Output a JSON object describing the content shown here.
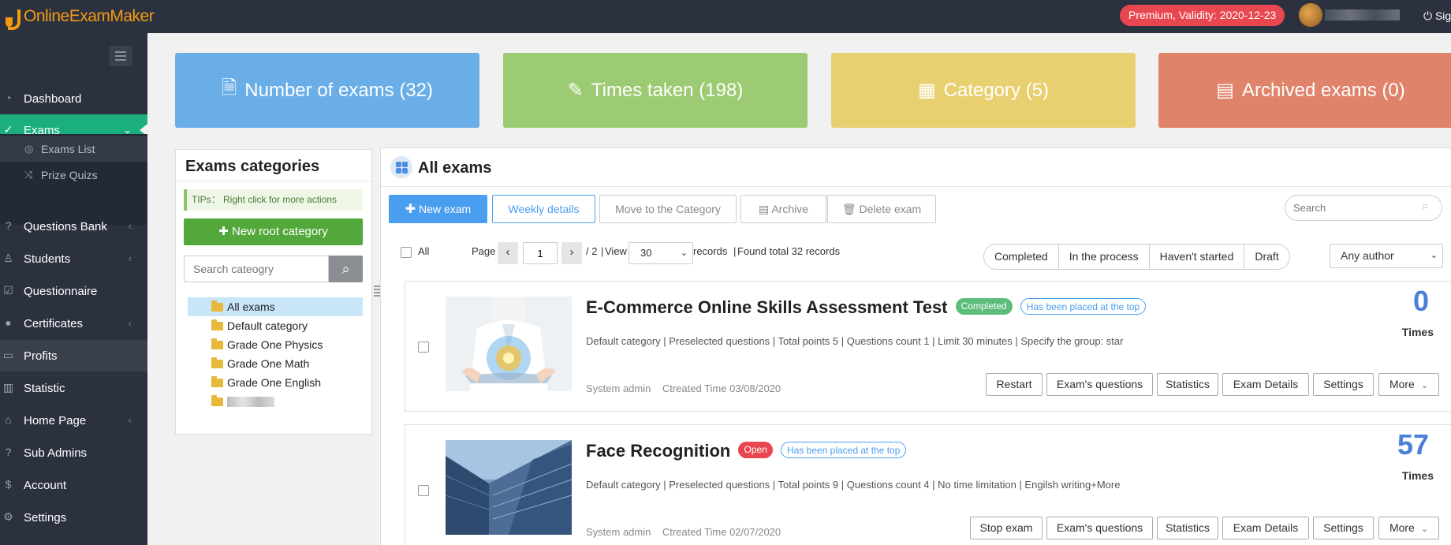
{
  "app": {
    "logo": "OnlineExamMaker"
  },
  "topbar": {
    "premium": "Premium, Validity: 2020-12-23",
    "signout_label": "Sig"
  },
  "sidebar": {
    "items": [
      {
        "label": "Dashboard",
        "icon": "dashboard-icon"
      },
      {
        "label": "Exams",
        "icon": "check-circle-icon",
        "active": true
      },
      {
        "label": "Questions Bank",
        "icon": "question-icon"
      },
      {
        "label": "Students",
        "icon": "user-icon"
      },
      {
        "label": "Questionnaire",
        "icon": "checkbox-icon"
      },
      {
        "label": "Certificates",
        "icon": "certificate-icon"
      },
      {
        "label": "Profits",
        "icon": "credit-card-icon"
      },
      {
        "label": "Statistic",
        "icon": "bar-chart-icon"
      },
      {
        "label": "Home Page",
        "icon": "home-icon"
      },
      {
        "label": "Sub Admins",
        "icon": "question-icon"
      },
      {
        "label": "Account",
        "icon": "dollar-icon"
      },
      {
        "label": "Settings",
        "icon": "gear-icon"
      }
    ],
    "sub_items": [
      {
        "label": "Exams List",
        "icon": "check-circle-icon"
      },
      {
        "label": "Prize Quizs",
        "icon": "shuffle-icon"
      }
    ]
  },
  "stats": [
    {
      "label": "Number of exams (32)",
      "color": "#6aaee8",
      "icon": "document-icon"
    },
    {
      "label": "Times taken (198)",
      "color": "#9ccb73",
      "icon": "edit-icon"
    },
    {
      "label": "Category (5)",
      "color": "#e8d070",
      "icon": "grid-icon"
    },
    {
      "label": "Archived exams (0)",
      "color": "#e0836b",
      "icon": "archive-icon"
    }
  ],
  "categories": {
    "title": "Exams categories",
    "tips": "TIPs： Right click for more actions",
    "new_root": "New root category",
    "search_placeholder": "Search cateogry",
    "tree": [
      "All exams",
      "Default category",
      "Grade One Physics",
      "Grade One Math",
      "Grade One English"
    ]
  },
  "main": {
    "title": "All exams",
    "toolbar": {
      "new_exam": "New exam",
      "weekly": "Weekly details",
      "move": "Move to the Category",
      "archive": "Archive",
      "delete": "Delete exam"
    },
    "search_placeholder": "Search",
    "pagination": {
      "all_label": "All",
      "page_label": "Page",
      "page_value": "1",
      "total_pages": "/ 2",
      "view_label": "View",
      "per_page": "30",
      "records_label": "records",
      "found": "Found total 32 records"
    },
    "filters": [
      "Completed",
      "In the process",
      "Haven't started",
      "Draft"
    ],
    "author_select": "Any author",
    "exams": [
      {
        "title": "E-Commerce Online Skills Assessment Test",
        "status": "Completed",
        "status_color": "#5cbd7b",
        "pinned": "Has been placed at the top",
        "meta": "Default category | Preselected questions | Total points 5 | Questions count 1 | Limit 30 minutes | Specify the group: star",
        "author": "System admin",
        "created": "Ctreated Time 03/08/2020",
        "count": "0",
        "times_label": "Times",
        "actions": [
          "Restart",
          "Exam's questions",
          "Statistics",
          "Exam Details",
          "Settings",
          "More"
        ]
      },
      {
        "title": "Face Recognition",
        "status": "Open",
        "status_color": "#e8474f",
        "pinned": "Has been placed at the top",
        "meta": "Default category | Preselected questions | Total points 9 | Questions count 4 | No time limitation | Engilsh writing+More",
        "author": "System admin",
        "created": "Ctreated Time 02/07/2020",
        "count": "57",
        "times_label": "Times",
        "actions": [
          "Stop exam",
          "Exam's questions",
          "Statistics",
          "Exam Details",
          "Settings",
          "More"
        ]
      }
    ]
  }
}
